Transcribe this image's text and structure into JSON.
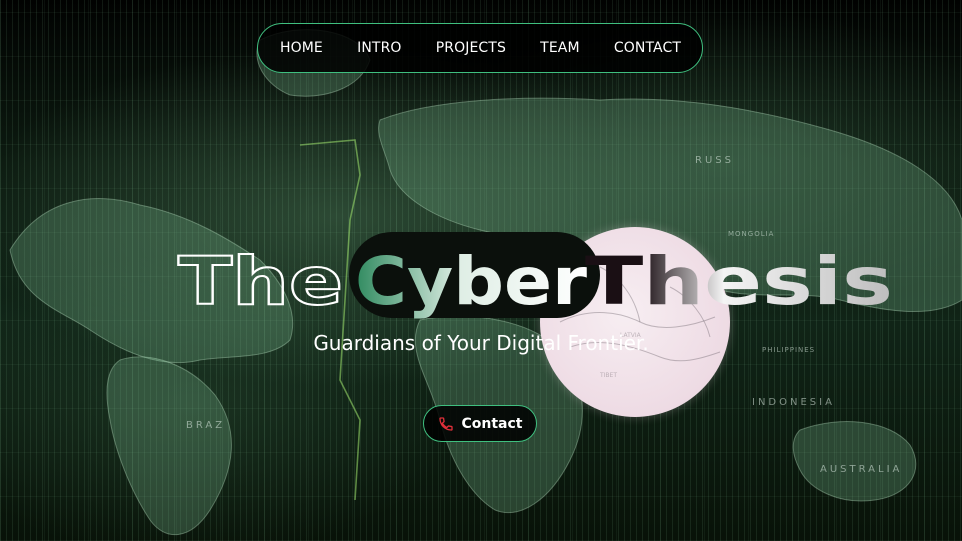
{
  "nav": {
    "items": [
      {
        "label": "HOME"
      },
      {
        "label": "INTRO"
      },
      {
        "label": "PROJECTS"
      },
      {
        "label": "TEAM"
      },
      {
        "label": "CONTACT"
      }
    ]
  },
  "hero": {
    "title_parts": [
      "The",
      "Cyber",
      "Thesis"
    ],
    "subtitle": "Guardians of Your Digital Frontier.",
    "cta_label": "Contact",
    "cta_icon": "phone-icon"
  },
  "map_labels": {
    "russia": "RUSS",
    "indonesia": "INDONESIA",
    "australia": "AUSTRALIA",
    "brazil": "BRAZ",
    "mongolia": "MONGOLIA",
    "philippines": "PHILIPPINES"
  },
  "colors": {
    "accent": "#3fbf7f",
    "background": "#030604",
    "cyber_gradient_start": "#2f8a5f",
    "cyber_gradient_end": "#ffffff",
    "thesis_fill": "#eaeaea",
    "blob": "#f3e4eb"
  }
}
